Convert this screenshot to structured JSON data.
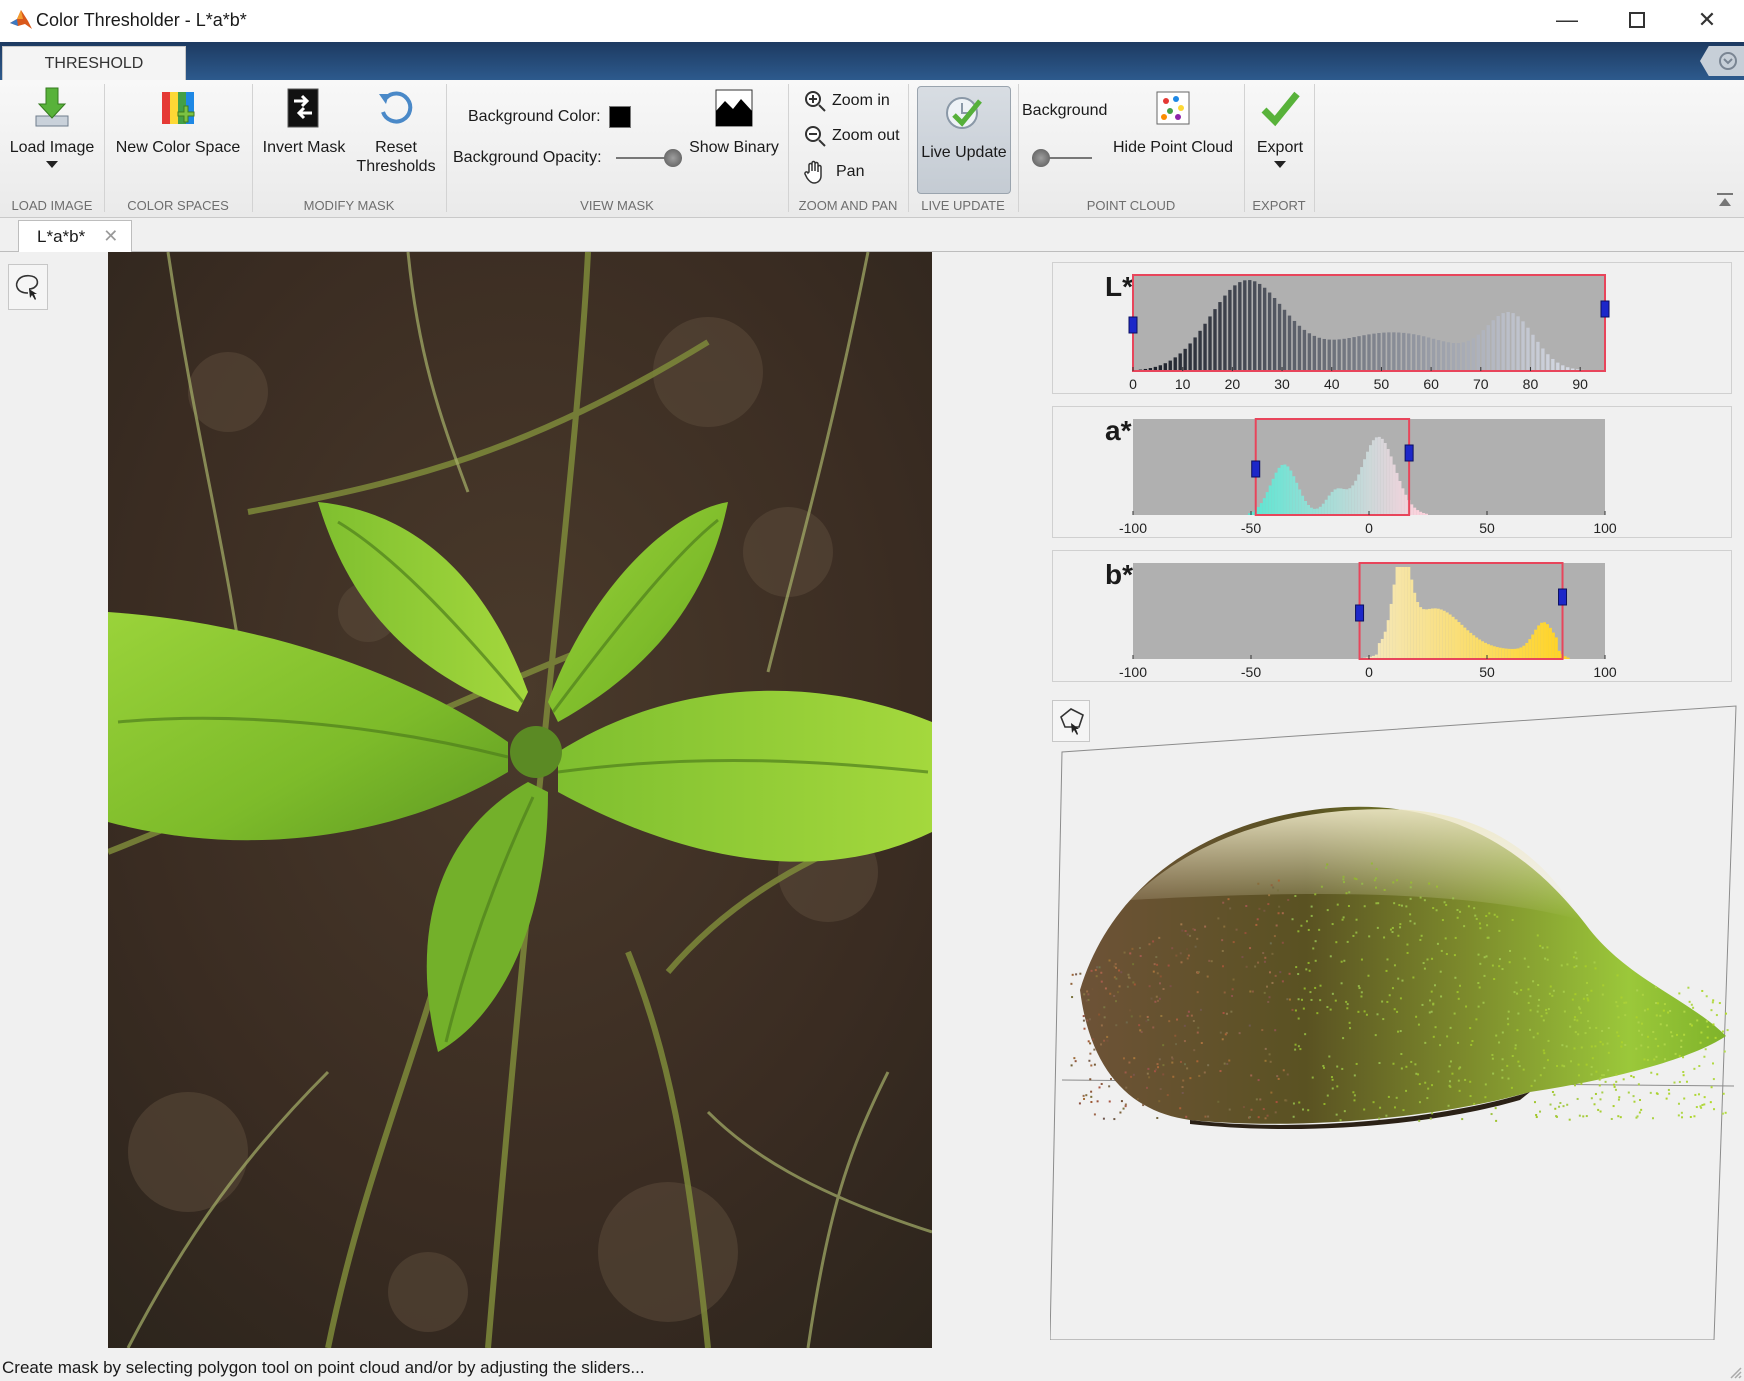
{
  "window": {
    "title": "Color Thresholder - L*a*b*",
    "icon": "matlab-logo-icon",
    "controls": [
      "minimize-icon",
      "maximize-icon",
      "close-icon"
    ]
  },
  "ribbon": {
    "tab": "THRESHOLD",
    "sections": {
      "load_image": "LOAD IMAGE",
      "color_spaces": "COLOR SPACES",
      "modify_mask": "MODIFY MASK",
      "view_mask": "VIEW MASK",
      "zoom_and_pan": "ZOOM AND PAN",
      "live_update": "LIVE UPDATE",
      "point_cloud": "POINT CLOUD",
      "export": "EXPORT"
    },
    "buttons": {
      "load_image": "Load Image",
      "new_color_space": "New Color Space",
      "invert_mask": "Invert Mask",
      "reset_thresholds_1": "Reset",
      "reset_thresholds_2": "Thresholds",
      "background_color": "Background Color:",
      "background_opacity": "Background Opacity:",
      "show_binary": "Show Binary",
      "zoom_in": "Zoom in",
      "zoom_out": "Zoom out",
      "pan": "Pan",
      "live_update": "Live Update",
      "background": "Background",
      "hide_point_cloud": "Hide Point Cloud",
      "export": "Export"
    },
    "background_color_value": "#000000",
    "background_opacity_value": 1.0,
    "point_cloud_background_value": 0.0
  },
  "document_tab": {
    "label": "L*a*b*"
  },
  "histograms": [
    {
      "channel": "L*",
      "xlim": [
        0,
        95
      ],
      "ticks": [
        "0",
        "10",
        "20",
        "30",
        "40",
        "50",
        "60",
        "70",
        "80",
        "90"
      ],
      "range": [
        0,
        95
      ]
    },
    {
      "channel": "a*",
      "xlim": [
        -100,
        100
      ],
      "ticks": [
        "-100",
        "-50",
        "0",
        "50",
        "100"
      ],
      "range": [
        -48,
        17
      ]
    },
    {
      "channel": "b*",
      "xlim": [
        -100,
        100
      ],
      "ticks": [
        "-100",
        "-50",
        "0",
        "50",
        "100"
      ],
      "range": [
        -4,
        82
      ]
    }
  ],
  "status": {
    "text": "Create mask by selecting polygon tool on point cloud and/or by adjusting the sliders..."
  }
}
